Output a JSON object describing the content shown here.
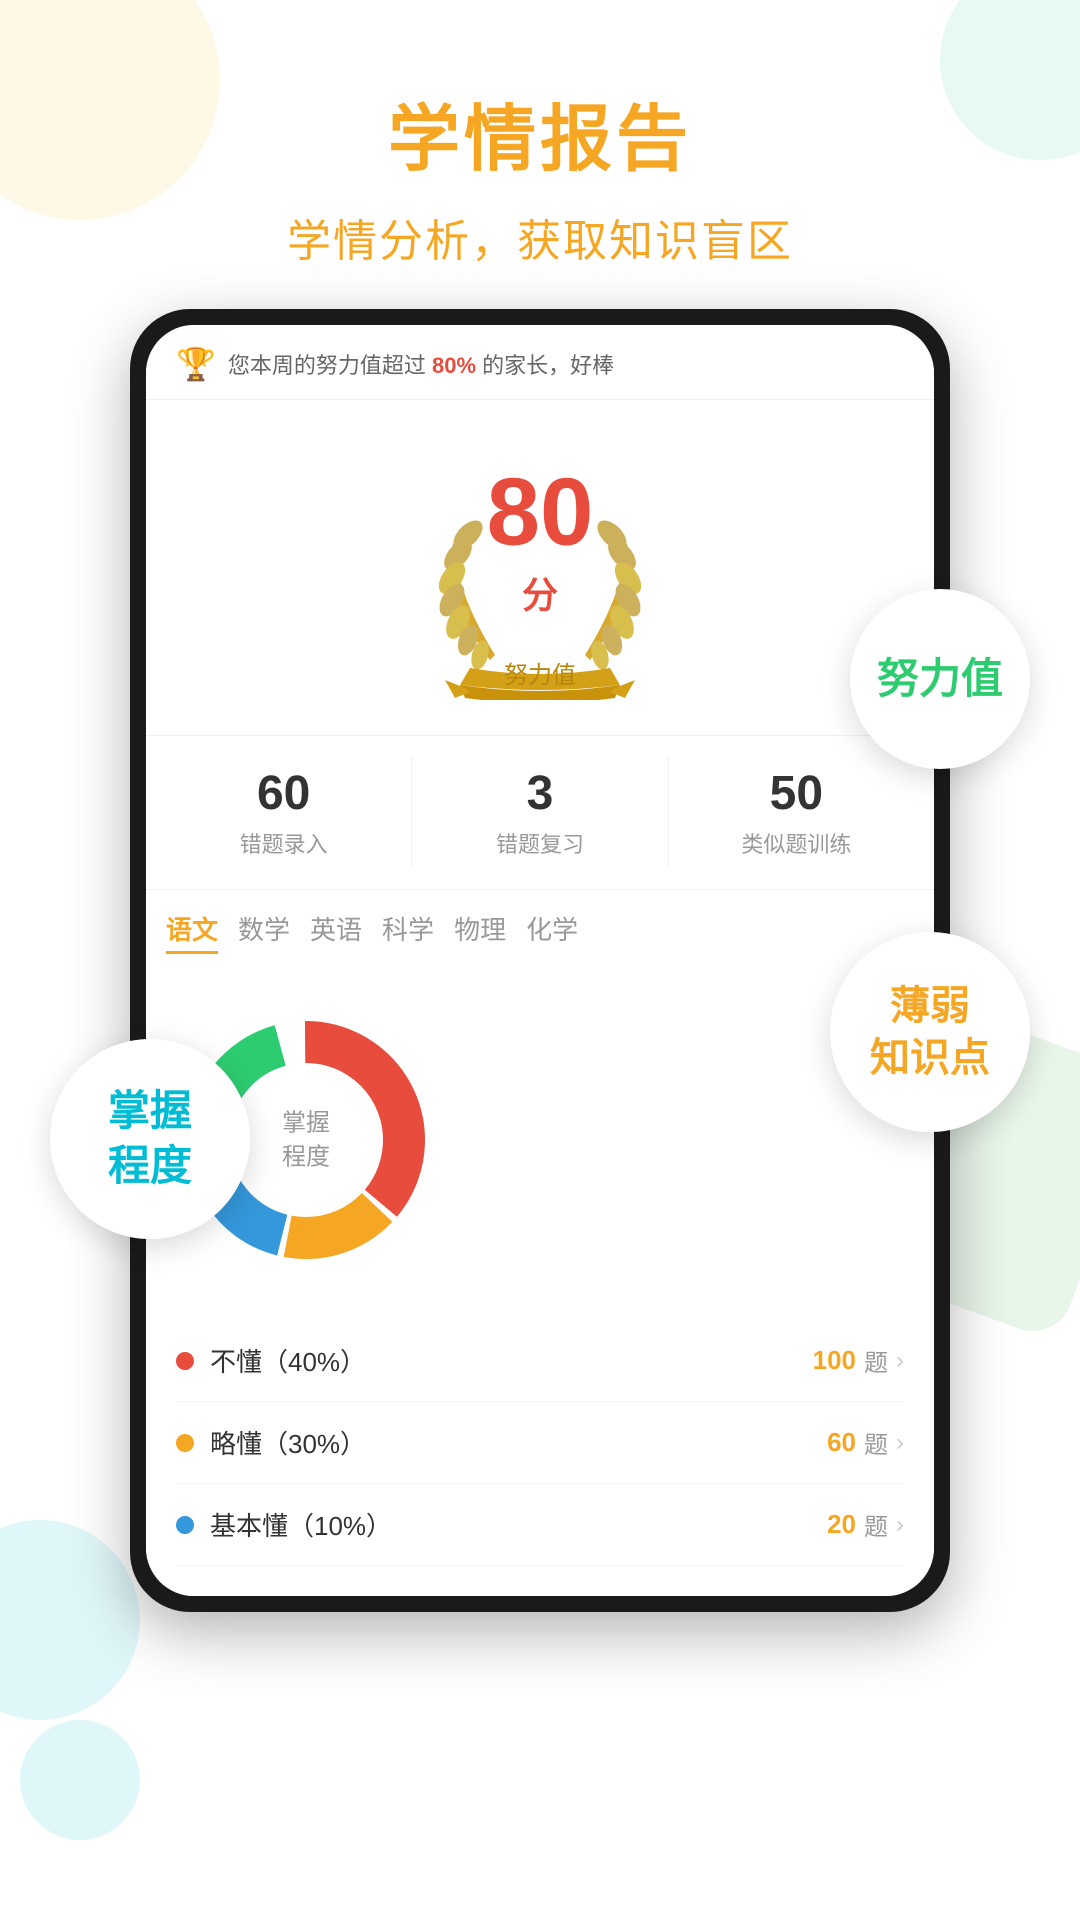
{
  "page": {
    "main_title": "学情报告",
    "sub_title": "学情分析，获取知识盲区"
  },
  "badges": {
    "nuli": "努力值",
    "zhangwo": "掌握\n程度",
    "ruodian": "薄弱\n知识点"
  },
  "notification": {
    "text": "您本周的努力值超过",
    "percent": "80%",
    "text2": "的家长，好棒"
  },
  "score": {
    "number": "80",
    "unit": "分",
    "label": "努力值"
  },
  "stats": [
    {
      "number": "60",
      "label": "错题录入"
    },
    {
      "number": "3",
      "label": "错题复习"
    },
    {
      "number": "50",
      "label": "类似题训练"
    }
  ],
  "subjects": [
    {
      "label": "语文",
      "active": true
    },
    {
      "label": "数学",
      "active": false
    },
    {
      "label": "英语",
      "active": false
    },
    {
      "label": "科学",
      "active": false
    },
    {
      "label": "物理",
      "active": false
    },
    {
      "label": "化学",
      "active": false
    }
  ],
  "chart": {
    "center_label": "掌握\n程度",
    "segments": [
      {
        "color": "#e74c3c",
        "percent": 40,
        "start": 0
      },
      {
        "color": "#f5a623",
        "percent": 20,
        "start": 144
      },
      {
        "color": "#3498db",
        "percent": 20,
        "start": 216
      },
      {
        "color": "#2ecc71",
        "percent": 20,
        "start": 288
      }
    ]
  },
  "legend": [
    {
      "dot_color": "#e74c3c",
      "label": "不懂（40%）",
      "count": "100",
      "unit": "题"
    },
    {
      "dot_color": "#f5a623",
      "label": "略懂（30%）",
      "count": "60",
      "unit": "题"
    },
    {
      "dot_color": "#3498db",
      "label": "基本懂（10%）",
      "count": "20",
      "unit": "题"
    }
  ]
}
